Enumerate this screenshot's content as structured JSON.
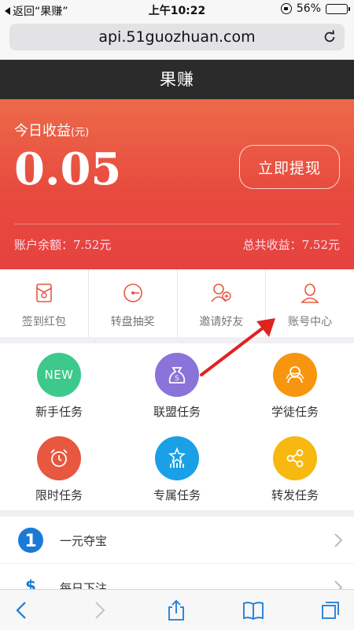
{
  "status_bar": {
    "back_label": "返回“果赚”",
    "time": "上午10:22",
    "battery_text": "56%",
    "battery_level": 0.56
  },
  "browser": {
    "url": "api.51guozhuan.com"
  },
  "app": {
    "title": "果赚"
  },
  "earnings": {
    "today_label": "今日收益",
    "today_unit": "(元)",
    "today_amount": "0.05",
    "withdraw_button": "立即提现",
    "balance_label": "账户余额：",
    "balance_value": "7.52元",
    "total_label": "总共收益：",
    "total_value": "7.52元"
  },
  "quick_actions": [
    {
      "label": "签到红包",
      "icon": "red-envelope-icon"
    },
    {
      "label": "转盘抽奖",
      "icon": "lottery-wheel-icon"
    },
    {
      "label": "邀请好友",
      "icon": "invite-friend-icon"
    },
    {
      "label": "账号中心",
      "icon": "account-icon"
    }
  ],
  "tasks": [
    {
      "label": "新手任务",
      "badge": "NEW",
      "color": "#3cc98b",
      "icon": "new-badge-icon"
    },
    {
      "label": "联盟任务",
      "color": "#8a73d9",
      "icon": "money-bag-icon"
    },
    {
      "label": "学徒任务",
      "color": "#f7950f",
      "icon": "apprentice-icon"
    },
    {
      "label": "限时任务",
      "color": "#e8573f",
      "icon": "alarm-clock-icon"
    },
    {
      "label": "专属任务",
      "color": "#1aa0e6",
      "icon": "star-chart-icon"
    },
    {
      "label": "转发任务",
      "color": "#f7b80f",
      "icon": "share-icon"
    }
  ],
  "list": [
    {
      "label": "一元夺宝",
      "icon": "number-one-icon"
    },
    {
      "label": "每日下注",
      "icon": "dollar-icon"
    }
  ],
  "colors": {
    "accent": "#e8483e",
    "header_bg": "#2b2b2b",
    "link_blue": "#1a7bd6"
  }
}
